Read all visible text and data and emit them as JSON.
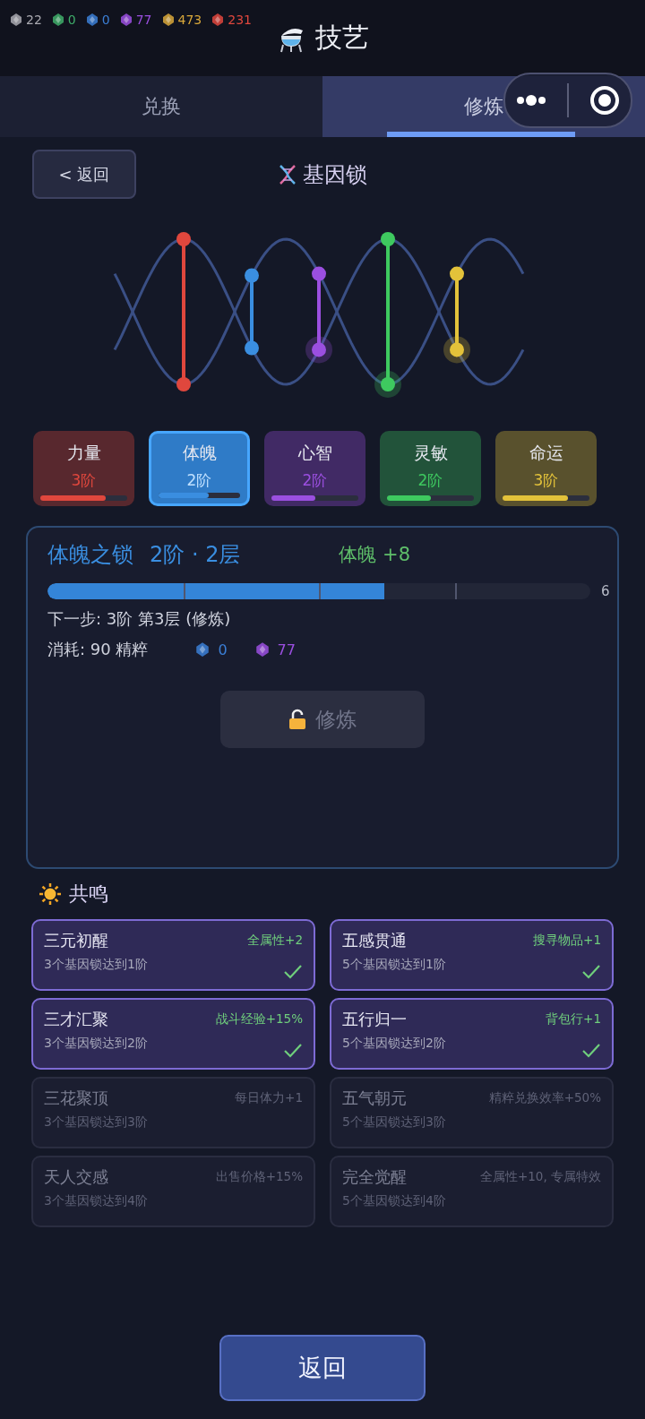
{
  "currencies": [
    {
      "value": "22",
      "color": "#a9a9b0"
    },
    {
      "value": "0",
      "color": "#3fae6a"
    },
    {
      "value": "0",
      "color": "#3b7fd6"
    },
    {
      "value": "77",
      "color": "#9b4fe0"
    },
    {
      "value": "473",
      "color": "#d9a83a"
    },
    {
      "value": "231",
      "color": "#e0473d"
    }
  ],
  "title": "技艺",
  "tabs": [
    {
      "label": "兑换",
      "selected": false
    },
    {
      "label": "修炼",
      "selected": true
    }
  ],
  "back_button": "< 返回",
  "section_title": "基因锁",
  "attributes": [
    {
      "name": "力量",
      "rank": "3阶",
      "level": 0.75,
      "color": "#e0473d",
      "selected": false
    },
    {
      "name": "体魄",
      "rank": "2阶",
      "level": 0.62,
      "color": "#3a8ee0",
      "selected": true
    },
    {
      "name": "心智",
      "rank": "2阶",
      "level": 0.5,
      "color": "#9b4fe0",
      "selected": false
    },
    {
      "name": "灵敏",
      "rank": "2阶",
      "level": 0.5,
      "color": "#3ec95f",
      "selected": false
    },
    {
      "name": "命运",
      "rank": "3阶",
      "level": 0.75,
      "color": "#e3c23a",
      "selected": false
    }
  ],
  "detail": {
    "title": "体魄之锁",
    "rank": "2阶 · 2层",
    "bonus": "体魄 +8",
    "progress": {
      "level": 0.62,
      "value": "6"
    },
    "next_step": "下一步: 3阶 第3层 (修炼)",
    "cost": "消耗: 90 精粹",
    "cost_items": [
      {
        "value": "0",
        "color": "#3b7fd6"
      },
      {
        "value": "77",
        "color": "#9b4fe0"
      }
    ],
    "button": {
      "label": "修炼",
      "disabled": true
    }
  },
  "resonance": {
    "title": "共鸣",
    "items": [
      {
        "name": "三元初醒",
        "effect": "全属性+2",
        "requirement": "3个基因锁达到1阶",
        "achieved": true
      },
      {
        "name": "五感贯通",
        "effect": "搜寻物品+1",
        "requirement": "5个基因锁达到1阶",
        "achieved": true
      },
      {
        "name": "三才汇聚",
        "effect": "战斗经验+15%",
        "requirement": "3个基因锁达到2阶",
        "achieved": true
      },
      {
        "name": "五行归一",
        "effect": "背包行+1",
        "requirement": "5个基因锁达到2阶",
        "achieved": true
      },
      {
        "name": "三花聚顶",
        "effect": "每日体力+1",
        "requirement": "3个基因锁达到3阶",
        "achieved": false
      },
      {
        "name": "五气朝元",
        "effect": "精粹兑换效率+50%",
        "requirement": "5个基因锁达到3阶",
        "achieved": false
      },
      {
        "name": "天人交感",
        "effect": "出售价格+15%",
        "requirement": "3个基因锁达到4阶",
        "achieved": false
      },
      {
        "name": "完全觉醒",
        "effect": "全属性+10, 专属特效",
        "requirement": "5个基因锁达到4阶",
        "achieved": false
      }
    ]
  },
  "bottom_button": "返回"
}
